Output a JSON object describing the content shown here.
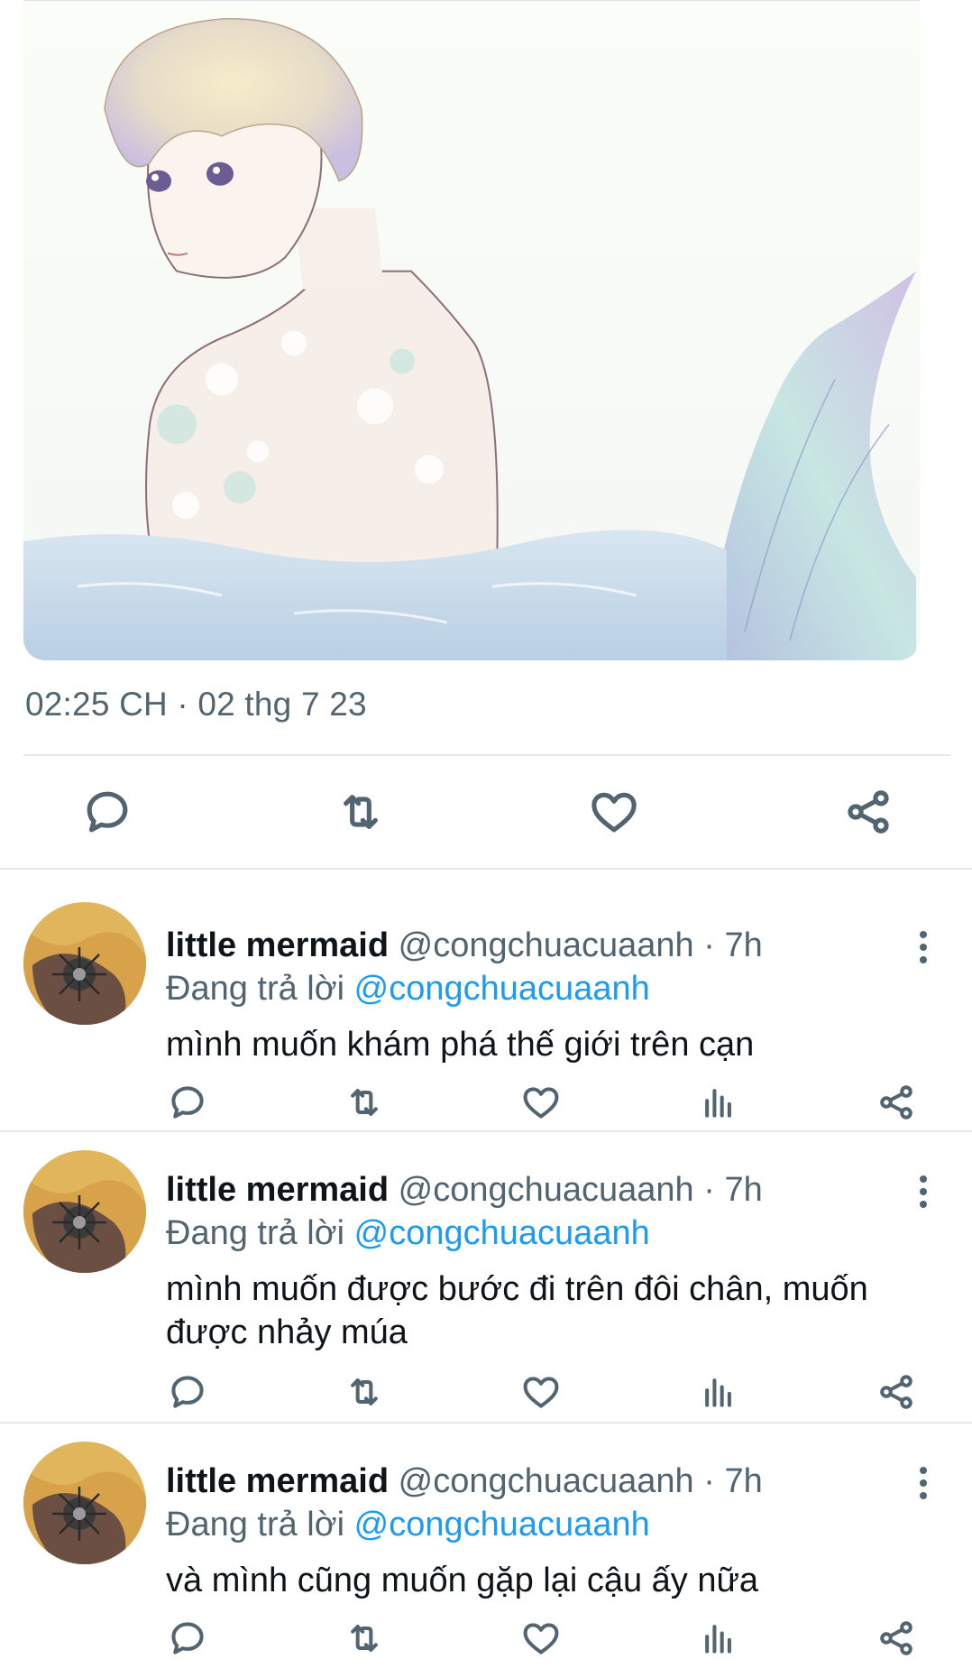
{
  "colors": {
    "text_primary": "#0f1419",
    "text_secondary": "#536471",
    "mention": "#1d9bf0",
    "divider": "#e6e9ec"
  },
  "main_tweet": {
    "timestamp": "02:25 CH · 02 thg 7 23",
    "media_alt_icon": "illustration-merman-image",
    "actions": [
      {
        "name": "reply",
        "icon": "reply-icon"
      },
      {
        "name": "retweet",
        "icon": "retweet-icon"
      },
      {
        "name": "like",
        "icon": "heart-icon"
      },
      {
        "name": "share",
        "icon": "share-icon"
      }
    ]
  },
  "replies": [
    {
      "name": "little mermaid",
      "handle": "@congchuacuaanh",
      "dot": "·",
      "time": "7h",
      "replying_prefix": "Đang trả lời",
      "replying_to": "@congchuacuaanh",
      "text": "mình muốn khám phá thế giới trên cạn"
    },
    {
      "name": "little mermaid",
      "handle": "@congchuacuaanh",
      "dot": "·",
      "time": "7h",
      "replying_prefix": "Đang trả lời",
      "replying_to": "@congchuacuaanh",
      "text": "mình muốn được bước đi trên đôi chân, muốn được nhảy múa"
    },
    {
      "name": "little mermaid",
      "handle": "@congchuacuaanh",
      "dot": "·",
      "time": "7h",
      "replying_prefix": "Đang trả lời",
      "replying_to": "@congchuacuaanh",
      "text": "và mình cũng muốn gặp lại cậu ấy nữa"
    }
  ]
}
